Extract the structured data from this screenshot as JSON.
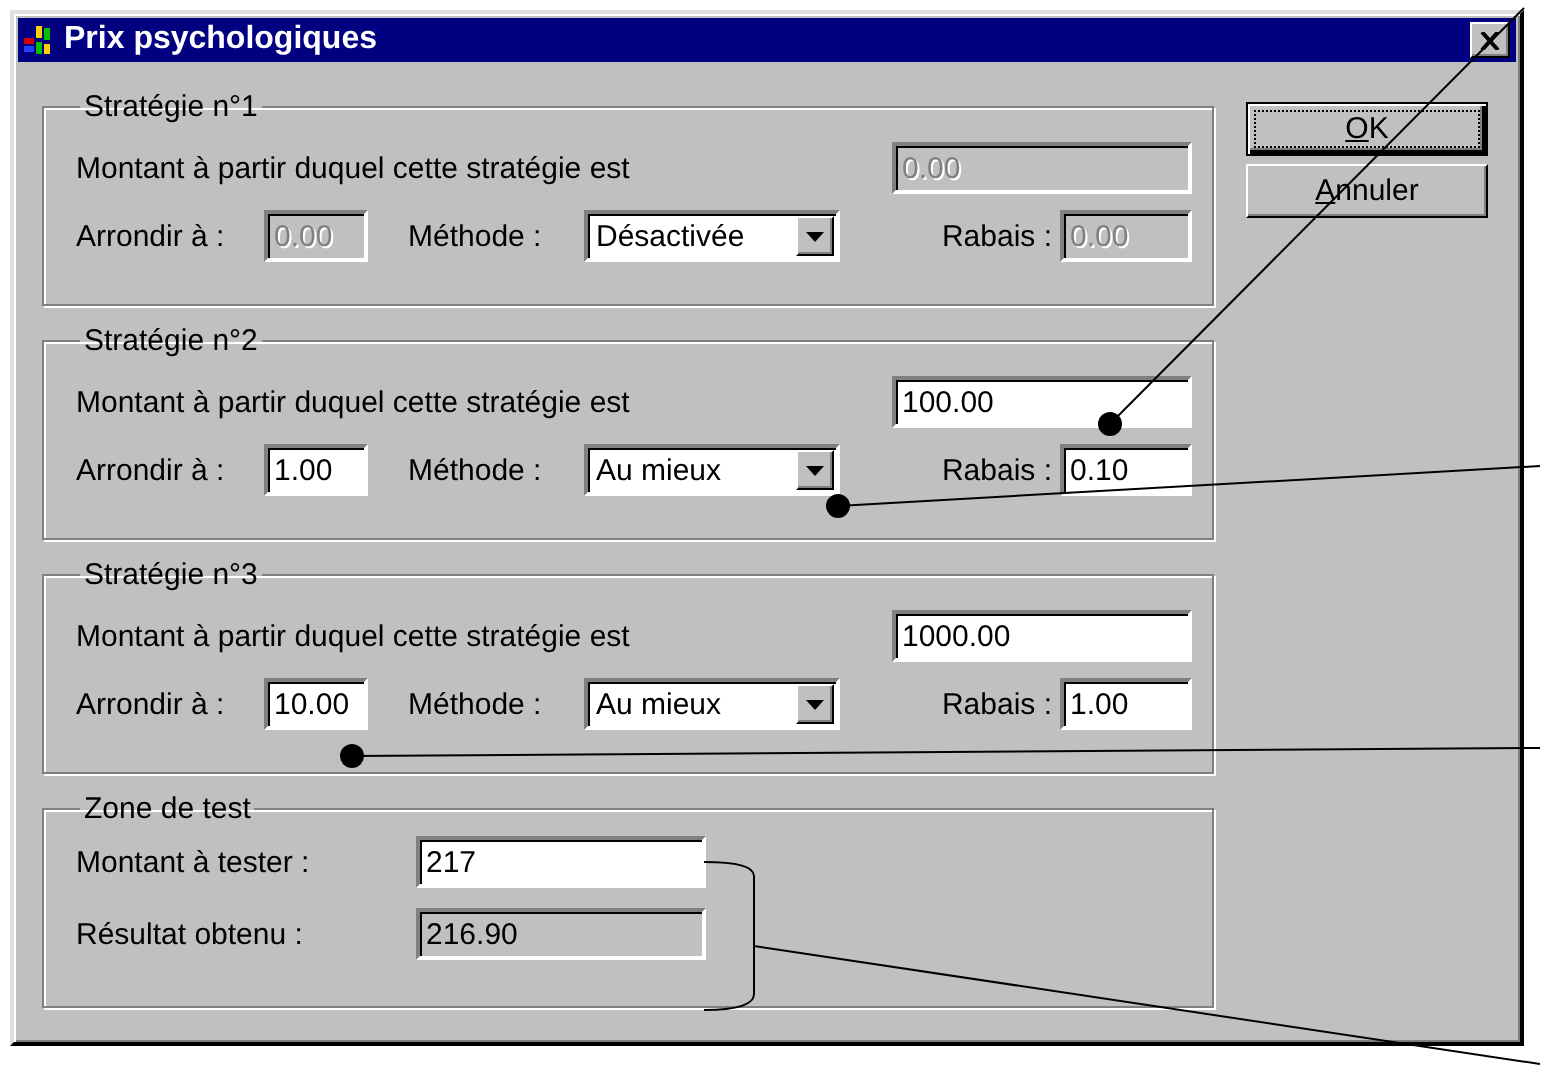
{
  "window": {
    "title": "Prix psychologiques"
  },
  "strategies": [
    {
      "title": "Stratégie n°1",
      "disabled": true,
      "threshold_label": "Montant à partir duquel cette stratégie est",
      "threshold": "0.00",
      "round_label": "Arrondir à :",
      "round": "0.00",
      "method_label": "Méthode :",
      "method": "Désactivée",
      "discount_label": "Rabais :",
      "discount": "0.00"
    },
    {
      "title": "Stratégie n°2",
      "disabled": false,
      "threshold_label": "Montant à partir duquel cette stratégie est",
      "threshold": "100.00",
      "round_label": "Arrondir à :",
      "round": "1.00",
      "method_label": "Méthode :",
      "method": "Au mieux",
      "discount_label": "Rabais :",
      "discount": "0.10"
    },
    {
      "title": "Stratégie n°3",
      "disabled": false,
      "threshold_label": "Montant à partir duquel cette stratégie est",
      "threshold": "1000.00",
      "round_label": "Arrondir à :",
      "round": "10.00",
      "method_label": "Méthode :",
      "method": "Au mieux",
      "discount_label": "Rabais :",
      "discount": "1.00"
    }
  ],
  "test_zone": {
    "title": "Zone de test",
    "amount_label": "Montant à tester :",
    "amount": "217",
    "result_label": "Résultat obtenu :",
    "result": "216.90",
    "result_read_only": true
  },
  "buttons": [
    {
      "label": "OK",
      "default": true
    },
    {
      "label": "Annuler",
      "default": false
    }
  ]
}
